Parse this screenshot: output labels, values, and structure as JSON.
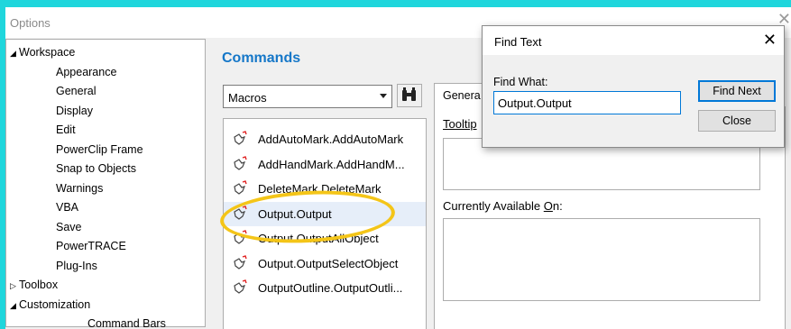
{
  "window": {
    "title": "Options",
    "close": "✕"
  },
  "tree": {
    "items": [
      {
        "label": "Workspace",
        "arrow": "◢",
        "indent": 0
      },
      {
        "label": "Appearance",
        "arrow": "",
        "indent": 1
      },
      {
        "label": "General",
        "arrow": "",
        "indent": 1
      },
      {
        "label": "Display",
        "arrow": "",
        "indent": 1
      },
      {
        "label": "Edit",
        "arrow": "",
        "indent": 1
      },
      {
        "label": "PowerClip Frame",
        "arrow": "",
        "indent": 1
      },
      {
        "label": "Snap to Objects",
        "arrow": "",
        "indent": 1
      },
      {
        "label": "Warnings",
        "arrow": "",
        "indent": 1
      },
      {
        "label": "VBA",
        "arrow": "",
        "indent": 1
      },
      {
        "label": "Save",
        "arrow": "",
        "indent": 1
      },
      {
        "label": "PowerTRACE",
        "arrow": "",
        "indent": 1
      },
      {
        "label": "Plug-Ins",
        "arrow": "",
        "indent": 1
      },
      {
        "label": "Toolbox",
        "arrow": "▷",
        "indent": 0
      },
      {
        "label": "Customization",
        "arrow": "◢",
        "indent": 0
      },
      {
        "label": "Command Bars",
        "arrow": "",
        "indent": 2
      }
    ]
  },
  "commands": {
    "title": "Commands",
    "dropdown_value": "Macros",
    "items": [
      {
        "label": "AddAutoMark.AddAutoMark"
      },
      {
        "label": "AddHandMark.AddHandM..."
      },
      {
        "label": "DeleteMark.DeleteMark"
      },
      {
        "label": "Output.Output"
      },
      {
        "label": "Output.OutputAllObject"
      },
      {
        "label": "Output.OutputSelectObject"
      },
      {
        "label": "OutputOutline.OutputOutli..."
      }
    ],
    "selected_index": 3
  },
  "right_pane": {
    "tab_label": "Genera",
    "tooltip_label": "Tooltip",
    "available_label_prefix": "Currently Available ",
    "available_label_underline": "O",
    "available_label_suffix": "n:"
  },
  "find_dialog": {
    "title": "Find Text",
    "close": "✕",
    "find_what_label": "Find What:",
    "find_what_value": "Output.Output",
    "find_next": "Find Next",
    "close_button": "Close"
  },
  "colors": {
    "background": "#1fd6dc",
    "accent": "#1577c8",
    "highlight": "#f4c518"
  }
}
